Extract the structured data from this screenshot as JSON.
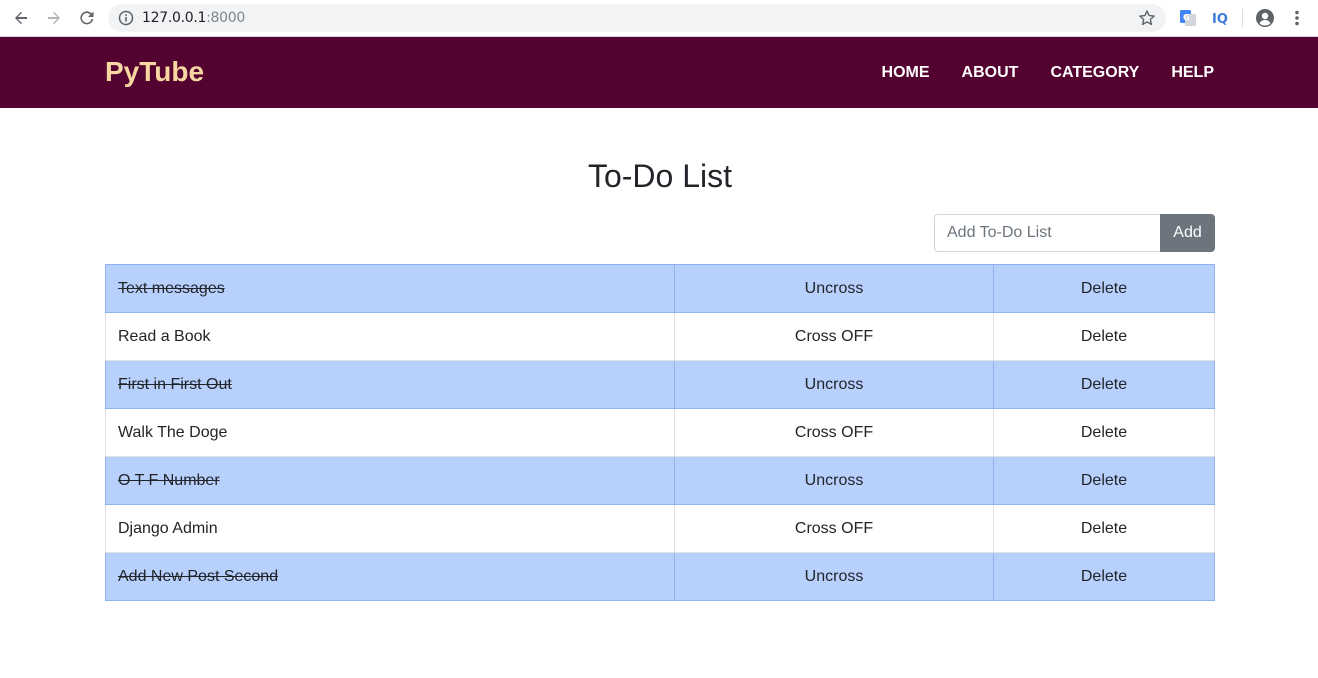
{
  "browser": {
    "url_host": "127.0.0.1",
    "url_port": ":8000"
  },
  "navbar": {
    "brand": "PyTube",
    "links": [
      {
        "label": "HOME"
      },
      {
        "label": "ABOUT"
      },
      {
        "label": "CATEGORY"
      },
      {
        "label": "HELP"
      }
    ]
  },
  "main": {
    "title": "To-Do List",
    "add_placeholder": "Add To-Do List",
    "add_label": "Add",
    "items": [
      {
        "text": "Text messages",
        "completed": true,
        "action": "Uncross",
        "delete": "Delete"
      },
      {
        "text": "Read a Book",
        "completed": false,
        "action": "Cross OFF",
        "delete": "Delete"
      },
      {
        "text": "First in First Out",
        "completed": true,
        "action": "Uncross",
        "delete": "Delete"
      },
      {
        "text": "Walk The Doge",
        "completed": false,
        "action": "Cross OFF",
        "delete": "Delete"
      },
      {
        "text": "O T F Number",
        "completed": true,
        "action": "Uncross",
        "delete": "Delete"
      },
      {
        "text": "Django Admin",
        "completed": false,
        "action": "Cross OFF",
        "delete": "Delete"
      },
      {
        "text": "Add New Post Second",
        "completed": true,
        "action": "Uncross",
        "delete": "Delete"
      }
    ]
  },
  "colors": {
    "navbar_bg": "#540230",
    "brand": "#f6d7a2",
    "completed_row": "#b8d0fc",
    "add_button": "#6c757d"
  }
}
